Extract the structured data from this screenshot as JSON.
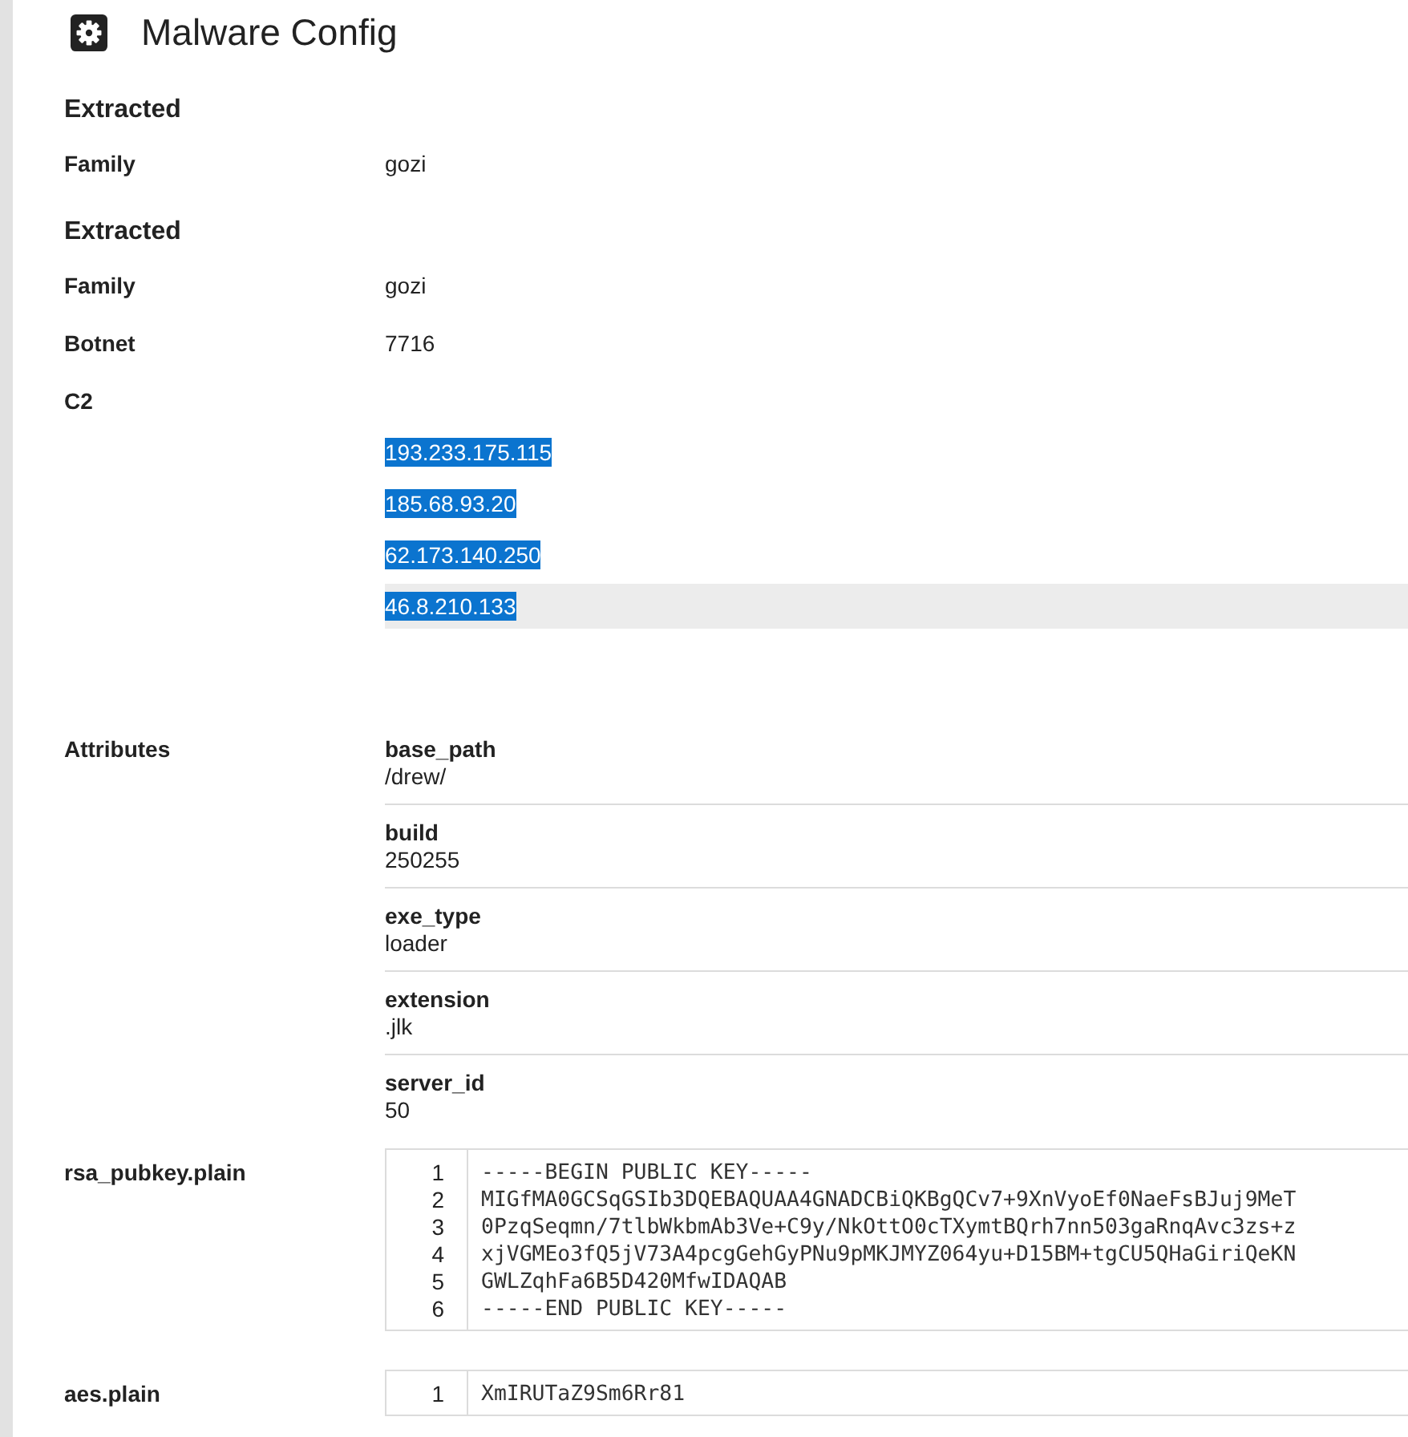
{
  "header": {
    "title": "Malware Config"
  },
  "sections": [
    {
      "heading": "Extracted",
      "fields": [
        {
          "label": "Family",
          "value": "gozi"
        }
      ]
    },
    {
      "heading": "Extracted",
      "fields": [
        {
          "label": "Family",
          "value": "gozi"
        },
        {
          "label": "Botnet",
          "value": "7716"
        }
      ],
      "c2": {
        "label": "C2",
        "addresses": [
          {
            "address": "193.233.175.115",
            "highlighted": true,
            "hovered": false
          },
          {
            "address": "185.68.93.20",
            "highlighted": true,
            "hovered": false
          },
          {
            "address": "62.173.140.250",
            "highlighted": true,
            "hovered": false
          },
          {
            "address": "46.8.210.133",
            "highlighted": true,
            "hovered": true
          }
        ]
      },
      "attributes": {
        "label": "Attributes",
        "items": [
          {
            "key": "base_path",
            "value": "/drew/"
          },
          {
            "key": "build",
            "value": "250255"
          },
          {
            "key": "exe_type",
            "value": "loader"
          },
          {
            "key": "extension",
            "value": ".jlk"
          },
          {
            "key": "server_id",
            "value": "50"
          }
        ]
      },
      "code_blocks": [
        {
          "label": "rsa_pubkey.plain",
          "lines": [
            {
              "number": "1",
              "text": "-----BEGIN PUBLIC KEY-----"
            },
            {
              "number": "2",
              "text": "MIGfMA0GCSqGSIb3DQEBAQUAA4GNADCBiQKBgQCv7+9XnVyoEf0NaeFsBJuj9MeT"
            },
            {
              "number": "3",
              "text": "0PzqSeqmn/7tlbWkbmAb3Ve+C9y/NkOttO0cTXymtBQrh7nn503gaRnqAvc3zs+z"
            },
            {
              "number": "4",
              "text": "xjVGMEo3fQ5jV73A4pcgGehGyPNu9pMKJMYZ064yu+D15BM+tgCU5QHaGiriQeKN"
            },
            {
              "number": "5",
              "text": "GWLZqhFa6B5D420MfwIDAQAB"
            },
            {
              "number": "6",
              "text": "-----END PUBLIC KEY-----"
            }
          ]
        },
        {
          "label": "aes.plain",
          "lines": [
            {
              "number": "1",
              "text": "XmIRUTaZ9Sm6Rr81"
            }
          ]
        }
      ]
    }
  ]
}
